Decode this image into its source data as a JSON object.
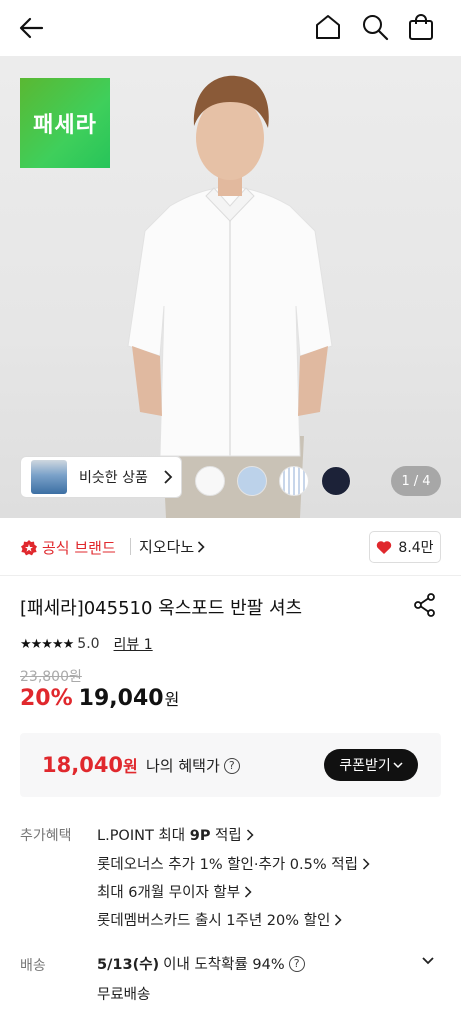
{
  "header": {
    "back_icon": "arrow-left-icon",
    "home_icon": "home-icon",
    "search_icon": "search-icon",
    "cart_icon": "shopping-bag-icon"
  },
  "hero": {
    "brand_logo_text": "패세라",
    "brand_logo_color": "#3fcf5b",
    "similar_label": "비슷한 상품",
    "swatches": [
      "#f8f8f8",
      "#bcd2ea",
      "#ffffff",
      "#1c2238"
    ],
    "counter_current": "1",
    "counter_sep": "/",
    "counter_total": "4"
  },
  "brand": {
    "official_label": "공식 브랜드",
    "name": "지오다노",
    "likes": "8.4만"
  },
  "product": {
    "title": "[패세라]045510 옥스포드 반팔 셔츠",
    "rating": "5.0",
    "review_label": "리뷰 1",
    "original_price": "23,800원",
    "discount": "20%",
    "price": "19,040",
    "price_unit": "원"
  },
  "benefit_price": {
    "amount": "18,040",
    "unit": "원",
    "label": "나의 혜택가",
    "coupon_label": "쿠폰받기"
  },
  "extra_benefits": {
    "label": "추가혜택",
    "lines": [
      {
        "pre": "L.POINT 최대 ",
        "bold": "9P",
        "post": " 적립"
      },
      {
        "pre": "롯데오너스 추가 1% 할인·추가 0.5% 적립",
        "bold": "",
        "post": ""
      },
      {
        "pre": "최대 6개월 무이자 할부",
        "bold": "",
        "post": ""
      },
      {
        "pre": "롯데멤버스카드 출시 1주년 20% 할인",
        "bold": "",
        "post": ""
      }
    ]
  },
  "shipping": {
    "label": "배송",
    "date": "5/13(수)",
    "text": " 이내 도착확률 94%",
    "fee": "무료배송"
  },
  "colors": {
    "accent_red": "#e0282d"
  }
}
